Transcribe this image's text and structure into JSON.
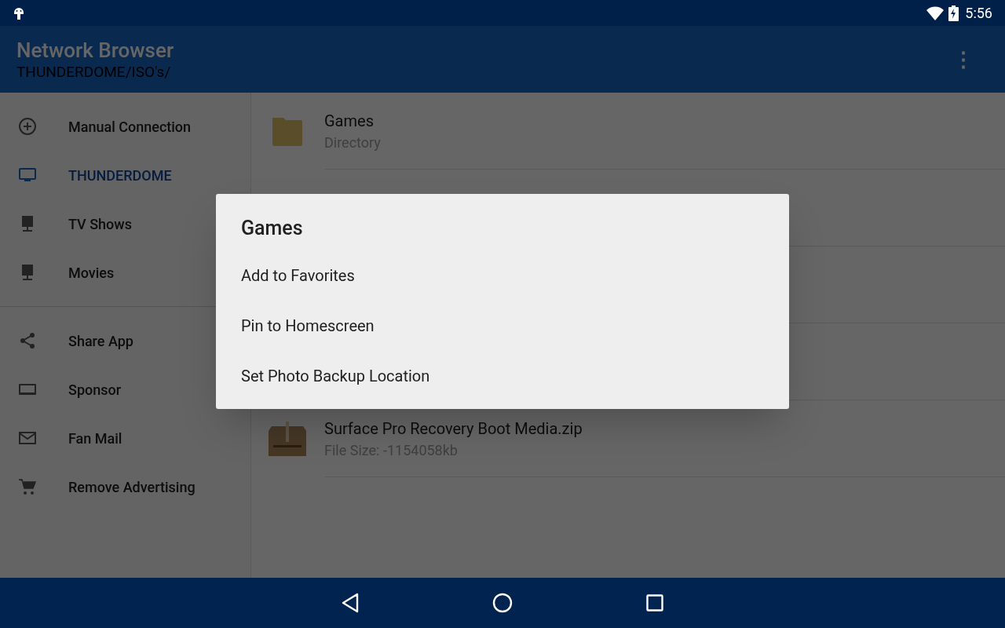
{
  "status_bar": {
    "time": "5:56"
  },
  "app_bar": {
    "title": "Network Browser",
    "subtitle": "THUNDERDOME/ISO's/",
    "menu_icon": "⋮"
  },
  "sidebar": {
    "groups": [
      {
        "items": [
          {
            "label": "Manual Connection",
            "selected": false
          },
          {
            "label": "THUNDERDOME",
            "selected": true
          },
          {
            "label": "TV Shows",
            "selected": false
          },
          {
            "label": "Movies",
            "selected": false
          }
        ]
      },
      {
        "items": [
          {
            "label": "Share App",
            "selected": false
          },
          {
            "label": "Sponsor",
            "selected": false
          },
          {
            "label": "Fan Mail",
            "selected": false
          },
          {
            "label": "Remove Advertising",
            "selected": false
          }
        ]
      }
    ]
  },
  "files": {
    "rows": [
      {
        "kind": "folder",
        "name": "Games",
        "detail": "Directory"
      },
      {
        "kind": "covered"
      },
      {
        "kind": "covered"
      },
      {
        "kind": "covered"
      },
      {
        "kind": "zip",
        "name": "Surface Pro Recovery Boot Media.zip",
        "detail": "File Size: -1154058kb"
      }
    ]
  },
  "dialog": {
    "title": "Games",
    "options": [
      "Add to Favorites",
      "Pin to Homescreen",
      "Set Photo Backup Location"
    ]
  }
}
